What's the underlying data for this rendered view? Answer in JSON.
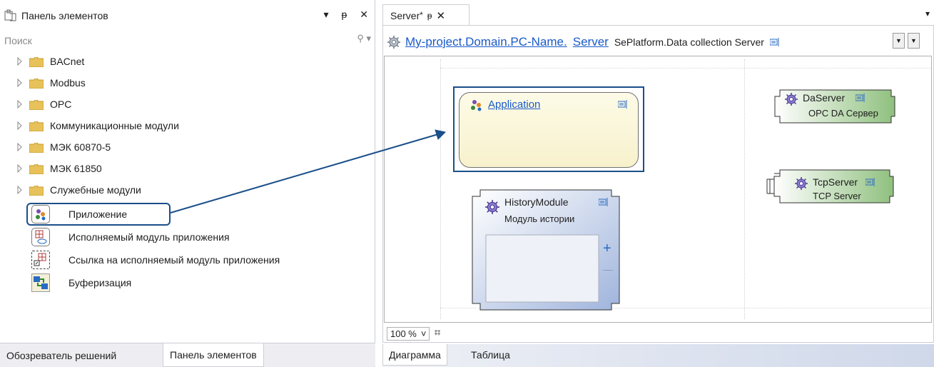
{
  "left_panel": {
    "title": "Панель элементов",
    "controls": {
      "dropdown": "▾",
      "pin": "ᵽ",
      "close": "✕"
    },
    "search": {
      "placeholder": "Поиск",
      "icon": "⚲ ▾"
    },
    "folders": [
      {
        "label": "BACnet"
      },
      {
        "label": "Modbus"
      },
      {
        "label": "OPC"
      },
      {
        "label": "Коммуникационные модули"
      },
      {
        "label": "МЭК 60870-5"
      },
      {
        "label": "МЭК 61850"
      },
      {
        "label": "Служебные модули"
      }
    ],
    "tools": [
      {
        "label": "Приложение"
      },
      {
        "label": "Исполняемый модуль приложения"
      },
      {
        "label": "Ссылка на исполняемый модуль приложения"
      },
      {
        "label": "Буферизация"
      }
    ],
    "bottom_tabs": [
      {
        "label": "Обозреватель решений"
      },
      {
        "label": "Панель элементов"
      }
    ]
  },
  "right_panel": {
    "doc_tab": {
      "label": "Server",
      "modified": "*",
      "pin": "ᵽ",
      "close": "✕"
    },
    "menu_arrow": "▾",
    "breadcrumb": {
      "path_link": "My-project.Domain.PC-Name.",
      "server_link": "Server",
      "type": "SePlatform.Data collection Server"
    },
    "diagram": {
      "application": {
        "title": "Application"
      },
      "history": {
        "title": "HistoryModule",
        "subtitle": "Модуль истории",
        "plus": "+",
        "minus": "—"
      },
      "da_server": {
        "title": "DaServer",
        "subtitle": "OPC DA Сервер"
      },
      "tcp_server": {
        "title": "TcpServer",
        "subtitle": "TCP Server"
      }
    },
    "zoom": {
      "value": "100 %",
      "dropdown": "˅",
      "grid_icon": "⌗"
    },
    "bottom_tabs": [
      {
        "label": "Диаграмма"
      },
      {
        "label": "Таблица"
      }
    ]
  },
  "colors": {
    "accent_blue": "#1a4f8a",
    "link_blue": "#1a5ac9",
    "app_fill": "#f7f1cc",
    "history_fill": "#c2d1ea",
    "server_fill": "#a9cf9c"
  }
}
